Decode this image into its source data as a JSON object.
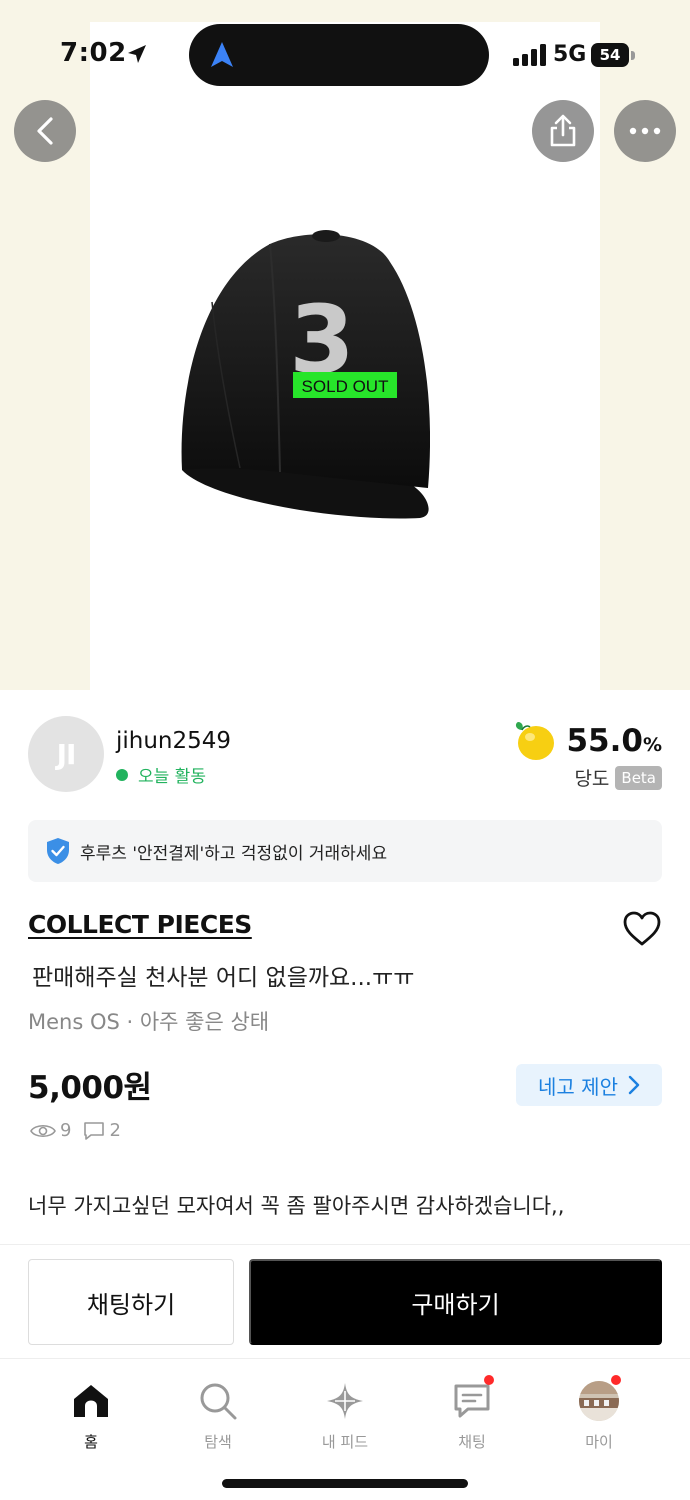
{
  "status_bar": {
    "time": "7:02",
    "network": "5G",
    "battery": "54"
  },
  "product_image": {
    "badge": "SOLD OUT",
    "number": "3",
    "badge_color": "#27e52a"
  },
  "seller": {
    "avatar_initials": "JI",
    "username": "jihun2549",
    "activity": "오늘 활동",
    "dangdo_value": "55.0",
    "dangdo_unit": "%",
    "dangdo_label": "당도",
    "beta_label": "Beta"
  },
  "safe_pay": {
    "text": "후루츠 '안전결제'하고 걱정없이 거래하세요"
  },
  "product": {
    "brand": "COLLECT PIECES",
    "title": "판매해주실 천사분 어디 없을까요...ㅠㅠ",
    "meta": "Mens OS · 아주 좋은 상태",
    "price": "5,000원",
    "offer_label": "네고 제안",
    "views": "9",
    "comments": "2",
    "description": "너무 가지고싶던 모자여서 꼭 좀 팔아주시면 감사하겠습니다,,"
  },
  "actions": {
    "chat_label": "채팅하기",
    "buy_label": "구매하기"
  },
  "tabs": [
    {
      "label": "홈",
      "icon": "home-icon",
      "active": true
    },
    {
      "label": "탐색",
      "icon": "search-icon",
      "active": false
    },
    {
      "label": "내 피드",
      "icon": "sparkle-icon",
      "active": false
    },
    {
      "label": "채팅",
      "icon": "chat-bubble-icon",
      "active": false
    },
    {
      "label": "마이",
      "icon": "profile-avatar-icon",
      "active": false
    }
  ],
  "colors": {
    "accent_blue": "#1b80e0",
    "activity_green": "#22b35e",
    "notification_red": "#ff2a2a",
    "hero_background": "#f8f5e7"
  }
}
